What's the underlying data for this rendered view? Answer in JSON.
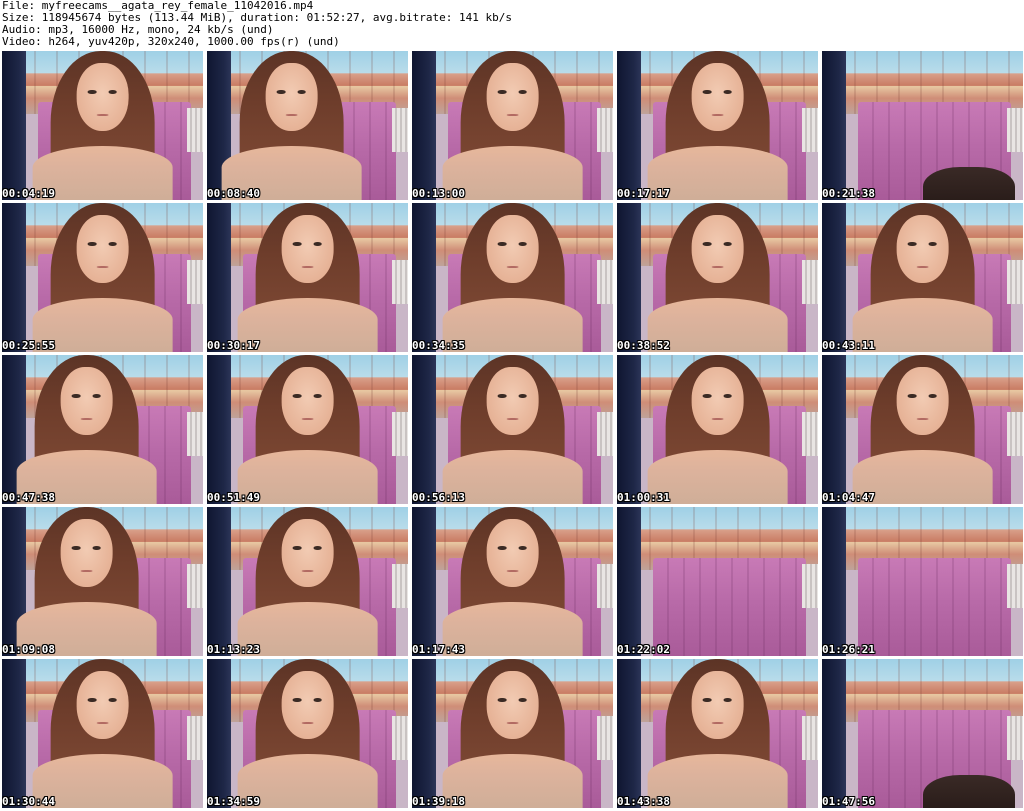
{
  "header": {
    "file_line": "File: myfreecams__agata_rey_female_11042016.mp4",
    "size_line": "Size: 118945674 bytes (113.44 MiB), duration: 01:52:27, avg.bitrate: 141 kb/s",
    "audio_line": "Audio: mp3, 16000 Hz, mono, 24 kb/s (und)",
    "video_line": "Video: h264, yuv420p, 320x240, 1000.00 fps(r) (und)"
  },
  "thumbnails": [
    {
      "timestamp": "00:04:19",
      "variant": "center"
    },
    {
      "timestamp": "00:08:40",
      "variant": "left"
    },
    {
      "timestamp": "00:13:00",
      "variant": "center"
    },
    {
      "timestamp": "00:17:17",
      "variant": "center"
    },
    {
      "timestamp": "00:21:38",
      "variant": "empty-chair"
    },
    {
      "timestamp": "00:25:55",
      "variant": "center"
    },
    {
      "timestamp": "00:30:17",
      "variant": "center"
    },
    {
      "timestamp": "00:34:35",
      "variant": "center"
    },
    {
      "timestamp": "00:38:52",
      "variant": "center"
    },
    {
      "timestamp": "00:43:11",
      "variant": "center"
    },
    {
      "timestamp": "00:47:38",
      "variant": "left"
    },
    {
      "timestamp": "00:51:49",
      "variant": "center"
    },
    {
      "timestamp": "00:56:13",
      "variant": "center"
    },
    {
      "timestamp": "01:00:31",
      "variant": "center"
    },
    {
      "timestamp": "01:04:47",
      "variant": "center"
    },
    {
      "timestamp": "01:09:08",
      "variant": "left"
    },
    {
      "timestamp": "01:13:23",
      "variant": "center"
    },
    {
      "timestamp": "01:17:43",
      "variant": "center"
    },
    {
      "timestamp": "01:22:02",
      "variant": "empty"
    },
    {
      "timestamp": "01:26:21",
      "variant": "empty"
    },
    {
      "timestamp": "01:30:44",
      "variant": "center"
    },
    {
      "timestamp": "01:34:59",
      "variant": "center"
    },
    {
      "timestamp": "01:39:18",
      "variant": "center"
    },
    {
      "timestamp": "01:43:38",
      "variant": "center"
    },
    {
      "timestamp": "01:47:56",
      "variant": "empty-chair"
    }
  ]
}
